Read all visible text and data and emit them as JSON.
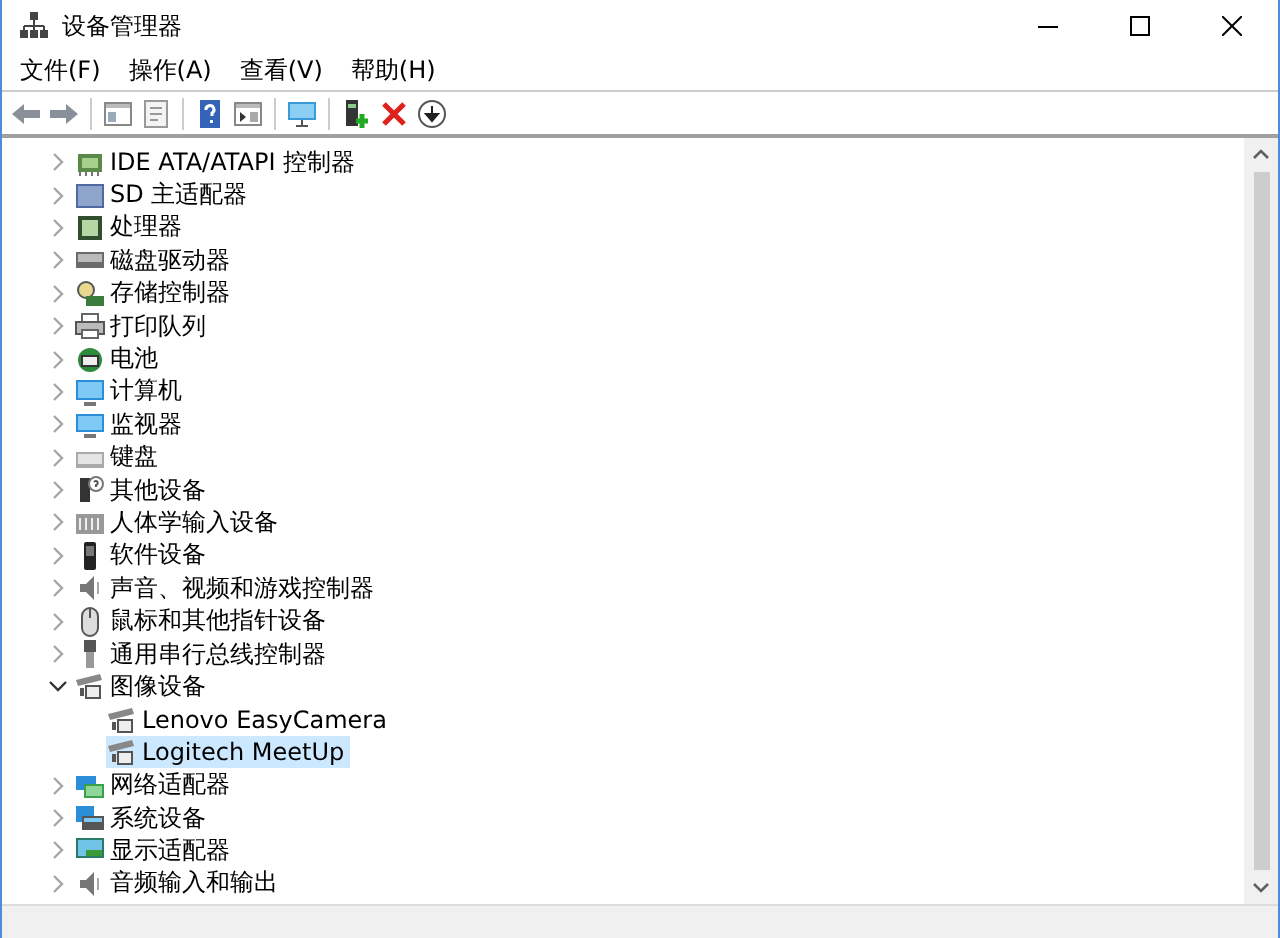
{
  "window": {
    "title": "设备管理器"
  },
  "menu": [
    {
      "label": "文件(F)"
    },
    {
      "label": "操作(A)"
    },
    {
      "label": "查看(V)"
    },
    {
      "label": "帮助(H)"
    }
  ],
  "tree": [
    {
      "label": "IDE ATA/ATAPI 控制器",
      "expanded": false,
      "selected": false
    },
    {
      "label": "SD 主适配器",
      "expanded": false,
      "selected": false
    },
    {
      "label": "处理器",
      "expanded": false,
      "selected": false
    },
    {
      "label": "磁盘驱动器",
      "expanded": false,
      "selected": false
    },
    {
      "label": "存储控制器",
      "expanded": false,
      "selected": false
    },
    {
      "label": "打印队列",
      "expanded": false,
      "selected": false
    },
    {
      "label": "电池",
      "expanded": false,
      "selected": false
    },
    {
      "label": "计算机",
      "expanded": false,
      "selected": false
    },
    {
      "label": "监视器",
      "expanded": false,
      "selected": false
    },
    {
      "label": "键盘",
      "expanded": false,
      "selected": false
    },
    {
      "label": "其他设备",
      "expanded": false,
      "selected": false
    },
    {
      "label": "人体学输入设备",
      "expanded": false,
      "selected": false
    },
    {
      "label": "软件设备",
      "expanded": false,
      "selected": false
    },
    {
      "label": "声音、视频和游戏控制器",
      "expanded": false,
      "selected": false
    },
    {
      "label": "鼠标和其他指针设备",
      "expanded": false,
      "selected": false
    },
    {
      "label": "通用串行总线控制器",
      "expanded": false,
      "selected": false
    },
    {
      "label": "图像设备",
      "expanded": true,
      "selected": false,
      "children": [
        {
          "label": "Lenovo EasyCamera",
          "selected": false
        },
        {
          "label": "Logitech MeetUp",
          "selected": true
        }
      ]
    },
    {
      "label": "网络适配器",
      "expanded": false,
      "selected": false
    },
    {
      "label": "系统设备",
      "expanded": false,
      "selected": false
    },
    {
      "label": "显示适配器",
      "expanded": false,
      "selected": false
    },
    {
      "label": "音频输入和输出",
      "expanded": false,
      "selected": false
    }
  ]
}
